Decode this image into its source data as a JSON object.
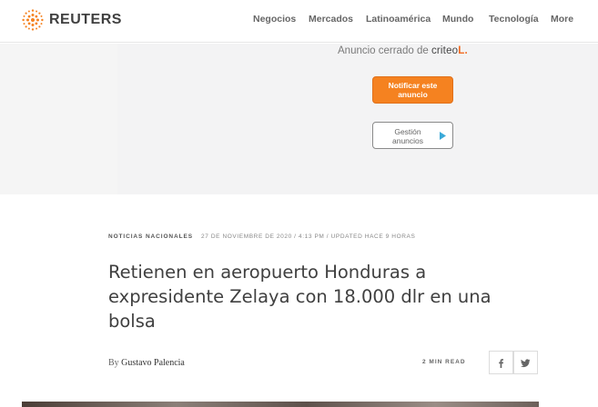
{
  "header": {
    "logo_text": "REUTERS",
    "logo_icon": "reuters-dot-logo",
    "nav": [
      {
        "label": "Negocios"
      },
      {
        "label": "Mercados"
      },
      {
        "label": "Latinoamérica"
      },
      {
        "label": "Mundo"
      },
      {
        "label": "Tecnología"
      },
      {
        "label": "More"
      }
    ]
  },
  "ad": {
    "closed_text": "Anuncio cerrado de",
    "provider": "criteo",
    "provider_mark": "L.",
    "notify_label": "Notificar este anuncio",
    "manage_label": "Gestión anuncios",
    "manage_icon": "adchoices-play-icon",
    "accent_color": "#f58220"
  },
  "article": {
    "kicker": "NOTICIAS NACIONALES",
    "dateline": "27 DE NOVIEMBRE DE 2020 / 4:13 PM / UPDATED HACE 9 HORAS",
    "headline": "Retienen en aeropuerto Honduras a expresidente Zelaya con 18.000 dlr en una bolsa",
    "byline_prefix": "By",
    "author": "Gustavo Palencia",
    "read_time": "2 MIN READ",
    "share": [
      {
        "icon": "facebook-icon"
      },
      {
        "icon": "twitter-icon"
      }
    ]
  }
}
